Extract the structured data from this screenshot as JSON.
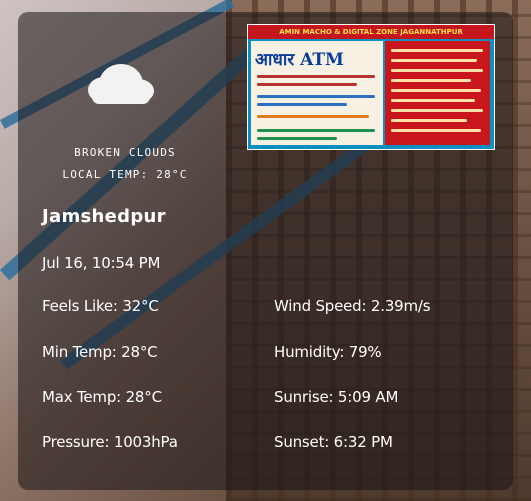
{
  "weather": {
    "icon": "cloud-icon",
    "description": "BROKEN CLOUDS",
    "local_temp": "LOCAL TEMP: 28°C"
  },
  "location": {
    "city": "Jamshedpur",
    "datetime": "Jul 16, 10:54 PM"
  },
  "stats": {
    "feels_like": "Feels Like: 32°C",
    "min_temp": "Min Temp: 28°C",
    "max_temp": "Max Temp: 28°C",
    "pressure": "Pressure: 1003hPa",
    "wind_speed": "Wind Speed: 2.39m/s",
    "humidity": "Humidity: 79%",
    "sunrise": "Sunrise: 5:09 AM",
    "sunset": "Sunset: 6:32 PM"
  },
  "ad": {
    "header": "AMIN MACHO & DIGITAL ZONE JAGANNATHPUR",
    "title": "आधार ATM"
  }
}
